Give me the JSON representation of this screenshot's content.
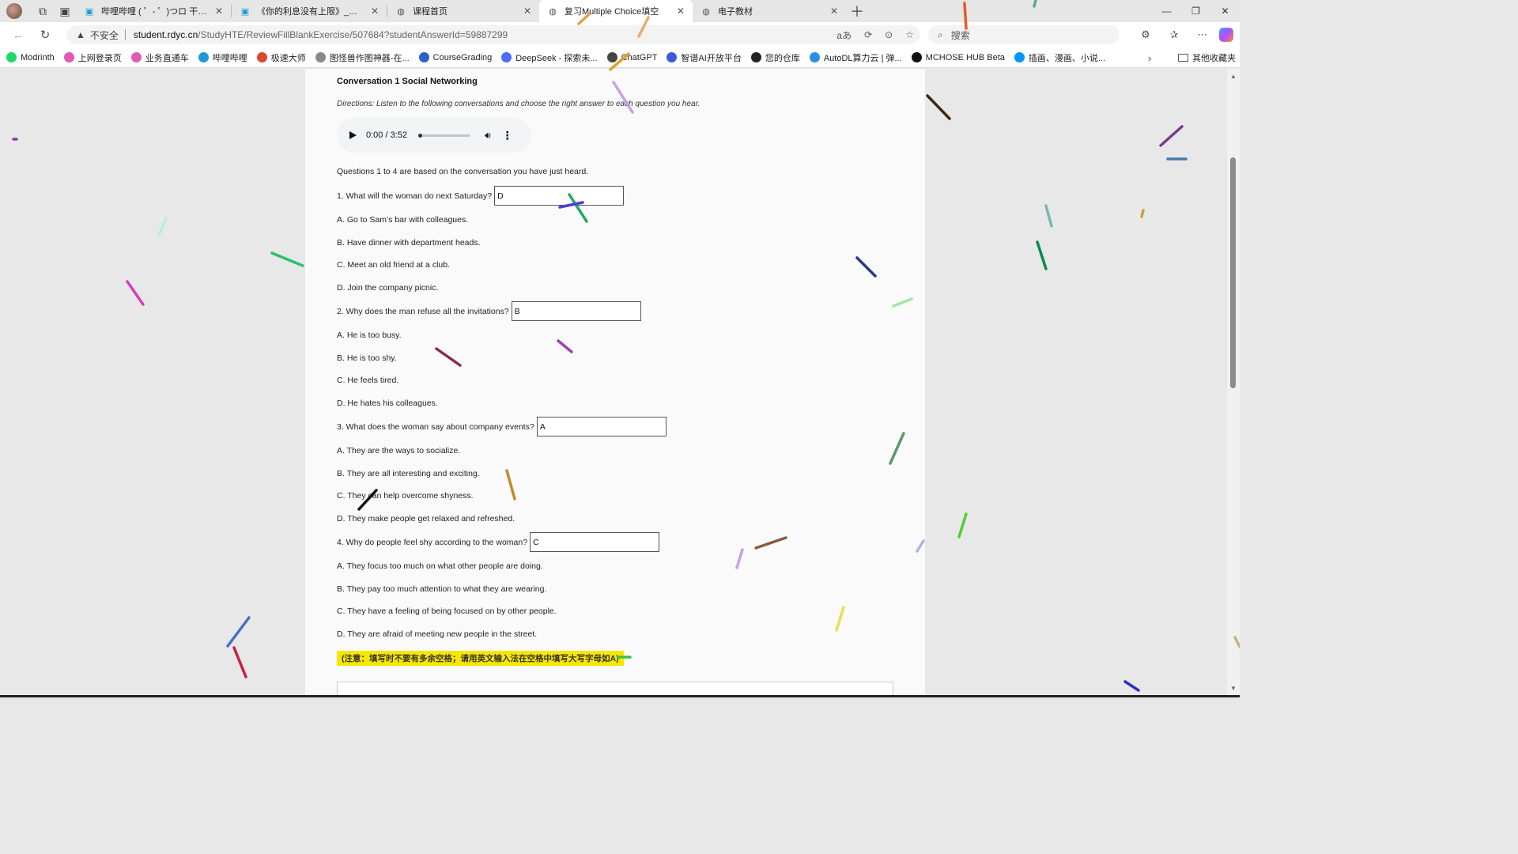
{
  "browser": {
    "tabs": [
      {
        "label": "哔哩哔哩 ( ゜- ゜)つロ 干杯~-bilibili",
        "icon": "bilibili-icon"
      },
      {
        "label": "《你的利息没有上限》_哔哩哔哩_bilibili",
        "icon": "bilibili-icon"
      },
      {
        "label": "课程首页",
        "icon": "globe-icon"
      },
      {
        "label": "复习Multiple Choice填空",
        "icon": "globe-icon",
        "active": true
      },
      {
        "label": "电子教材",
        "icon": "globe-icon"
      }
    ],
    "address": {
      "security_label": "不安全",
      "host": "student.rdyc.cn",
      "path": "/StudyHTE/ReviewFillBlankExercise/507684?studentAnswerId=59887299"
    },
    "search_placeholder": "搜索",
    "bookmarks": [
      {
        "label": "Modrinth",
        "icon": "modrinth-icon",
        "color": "#1bd96a"
      },
      {
        "label": "上网登录页",
        "icon": "login-icon",
        "color": "#e05bb0"
      },
      {
        "label": "业务直通车",
        "icon": "service-icon",
        "color": "#e05bb0"
      },
      {
        "label": "哔哩哔哩",
        "icon": "bilibili-icon",
        "color": "#1a9ad6"
      },
      {
        "label": "极速大师",
        "icon": "rocket-icon",
        "color": "#e0462f"
      },
      {
        "label": "图怪兽作图神器-在...",
        "icon": "image-icon",
        "color": "#888888"
      },
      {
        "label": "CourseGrading",
        "icon": "cg-icon",
        "color": "#2b62c6"
      },
      {
        "label": "DeepSeek - 探索未...",
        "icon": "deepseek-icon",
        "color": "#4d6bfe"
      },
      {
        "label": "ChatGPT",
        "icon": "chatgpt-icon",
        "color": "#444444"
      },
      {
        "label": "智谱AI开放平台",
        "icon": "zhipu-icon",
        "color": "#3b5bdb"
      },
      {
        "label": "您的仓库",
        "icon": "github-icon",
        "color": "#222222"
      },
      {
        "label": "AutoDL算力云 | 弹...",
        "icon": "autodl-icon",
        "color": "#2a8de8"
      },
      {
        "label": "MCHOSE HUB Beta",
        "icon": "mchose-icon",
        "color": "#111111"
      },
      {
        "label": "插画、漫画、小说...",
        "icon": "pixiv-icon",
        "color": "#0096fa"
      }
    ],
    "other_bookmarks": "其他收藏夹"
  },
  "exercise": {
    "title": "Conversation 1 Social Networking",
    "directions": "Directions: Listen to the following conversations and choose the right answer to each question you hear.",
    "audio_time": "0:00 / 3:52",
    "intro": "Questions 1 to 4 are based on the conversation you have just heard.",
    "questions": [
      {
        "text": "1. What will the woman do next Saturday?",
        "answer": "D",
        "options": [
          "A. Go to Sam’s bar with colleagues.",
          "B. Have dinner with department heads.",
          "C. Meet an old friend at a club.",
          "D. Join the company picnic."
        ]
      },
      {
        "text": "2. Why does the man refuse all the invitations?",
        "answer": "B",
        "options": [
          "A. He is too busy.",
          "B. He is too shy.",
          "C. He feels tired.",
          "D. He hates his colleagues."
        ]
      },
      {
        "text": "3. What does the woman say about company events?",
        "answer": "A",
        "options": [
          "A. They are the ways to socialize.",
          "B. They are all interesting and exciting.",
          "C. They can help overcome shyness.",
          "D. They make people get relaxed and refreshed."
        ]
      },
      {
        "text": "4. Why do people feel shy according to the woman?",
        "answer": "C",
        "options": [
          "A. They focus too much on what other people are doing.",
          "B. They pay too much attention to what they are wearing.",
          "C. They have a feeling of being focused on by other people.",
          "D. They are afraid of meeting new people in the street."
        ]
      }
    ],
    "note": "(注意：填写时不要有多余空格；请用英文输入法在空格中填写大写字母如A)"
  },
  "colors": {
    "note_highlight": "#f7e600",
    "tab_active": "#ffffff",
    "page_background": "#fafafa"
  }
}
